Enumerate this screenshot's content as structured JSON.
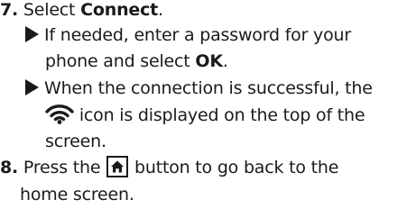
{
  "steps": [
    {
      "number": "7.",
      "text_before": "Select ",
      "bold": "Connect",
      "text_after": ".",
      "substeps": [
        {
          "line1": "If needed, enter a password for your",
          "line2_before": "phone and select ",
          "line2_bold": "OK",
          "line2_after": "."
        },
        {
          "line1": "When the connection is successful, the",
          "line2_after_icon": " icon is displayed on the top of the",
          "line3": "screen.",
          "icon": "wifi-icon"
        }
      ]
    },
    {
      "number": "8.",
      "text_before": "Press the ",
      "icon": "home-icon",
      "text_after": " button to go back to the",
      "line2": "home screen."
    }
  ]
}
